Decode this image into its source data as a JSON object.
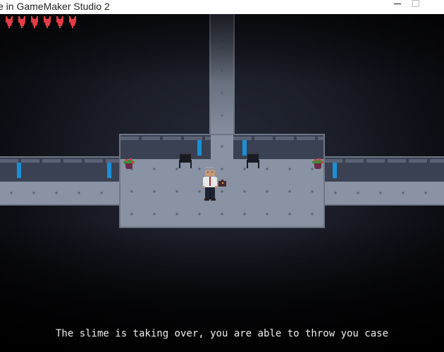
{
  "window": {
    "title": "e in GameMaker Studio 2",
    "controls": [
      "minimize",
      "maximize"
    ]
  },
  "hud": {
    "health": 6,
    "max_health": 6,
    "heart_icon": "heart-icon",
    "heart_color": "#e43b44"
  },
  "scene": {
    "accent_panel_color": "#1a8fd6",
    "floor_color": "#8a93a3",
    "wall_color": "#3a4152",
    "props": [
      "chair",
      "chair",
      "plant",
      "plant",
      "wall-light",
      "wall-light",
      "wall-light",
      "wall-light",
      "wall-light",
      "wall-light"
    ],
    "player": {
      "name": "office worker",
      "item": "briefcase"
    }
  },
  "dialog": {
    "text": "The slime is taking over, you are able to throw you case"
  }
}
